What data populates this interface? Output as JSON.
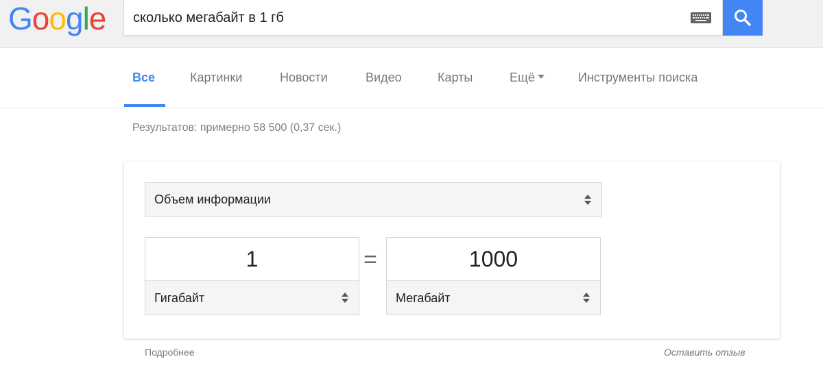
{
  "logo": {
    "letters": [
      "G",
      "o",
      "o",
      "g",
      "l",
      "e"
    ],
    "colors": [
      "#4285f4",
      "#ea4335",
      "#fbbc05",
      "#4285f4",
      "#34a853",
      "#ea4335"
    ]
  },
  "search": {
    "query": "сколько мегабайт в 1 гб",
    "keyboard_icon": "keyboard-icon",
    "button_icon": "search-icon",
    "accent": "#4285f4"
  },
  "tabs": [
    {
      "label": "Все",
      "active": true
    },
    {
      "label": "Картинки",
      "active": false
    },
    {
      "label": "Новости",
      "active": false
    },
    {
      "label": "Видео",
      "active": false
    },
    {
      "label": "Карты",
      "active": false
    },
    {
      "label": "Ещё",
      "active": false
    },
    {
      "label": "Инструменты поиска",
      "active": false
    }
  ],
  "result_stats": "Результатов: примерно 58 500 (0,37 сек.)",
  "converter": {
    "category": "Объем информации",
    "from": {
      "value": "1",
      "unit": "Гигабайт"
    },
    "equals_sign": "=",
    "to": {
      "value": "1000",
      "unit": "Мегабайт"
    }
  },
  "footer": {
    "more_link": "Подробнее",
    "feedback_link": "Оставить отзыв"
  }
}
